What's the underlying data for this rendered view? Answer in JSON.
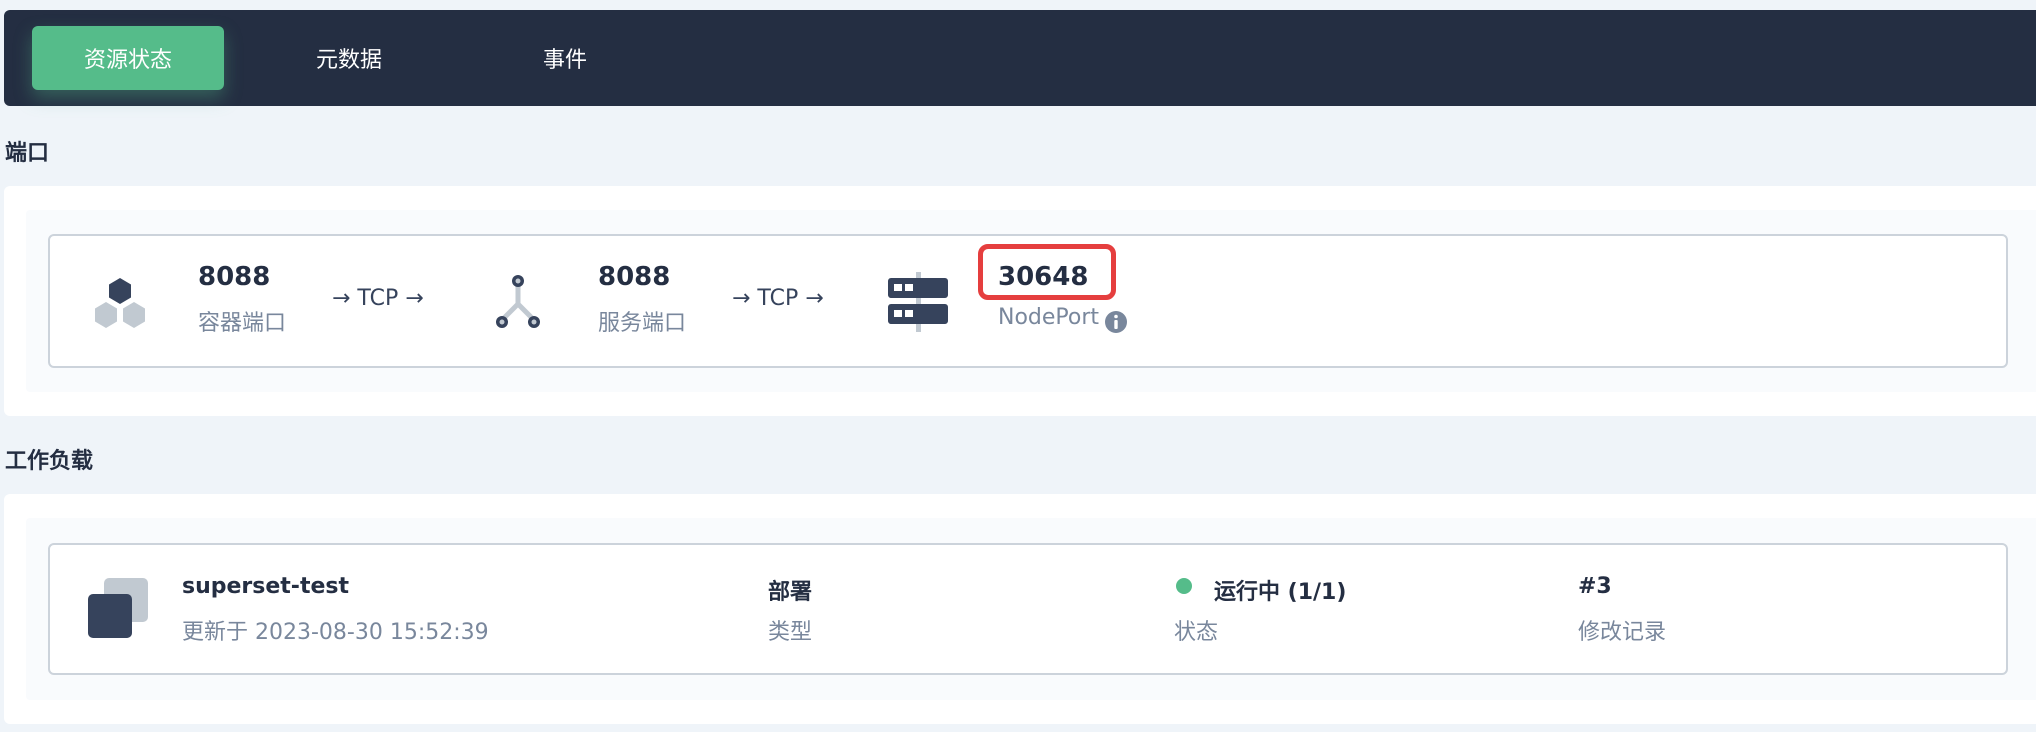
{
  "tabs": [
    {
      "label": "资源状态",
      "active": true
    },
    {
      "label": "元数据",
      "active": false
    },
    {
      "label": "事件",
      "active": false
    }
  ],
  "ports_section": {
    "title": "端口",
    "container_port": {
      "value": "8088",
      "label": "容器端口"
    },
    "protocol_1": "→ TCP →",
    "service_port": {
      "value": "8088",
      "label": "服务端口"
    },
    "protocol_2": "→ TCP →",
    "node_port": {
      "value": "30648",
      "label": "NodePort"
    },
    "icons": [
      "container-hexagons-icon",
      "service-branch-icon",
      "node-server-icon",
      "info-icon"
    ]
  },
  "workload_section": {
    "title": "工作负载",
    "name": "superset-test",
    "updated": "更新于 2023-08-30 15:52:39",
    "type_value": "部署",
    "type_label": "类型",
    "status_value": "运行中 (1/1)",
    "status_label": "状态",
    "revision_value": "#3",
    "revision_label": "修改记录",
    "icons": [
      "workload-stack-icon",
      "status-dot-icon"
    ]
  },
  "colors": {
    "accent": "#55bc8a",
    "dark": "#242e42",
    "highlight": "#e53e3e",
    "muted": "#79879c"
  }
}
